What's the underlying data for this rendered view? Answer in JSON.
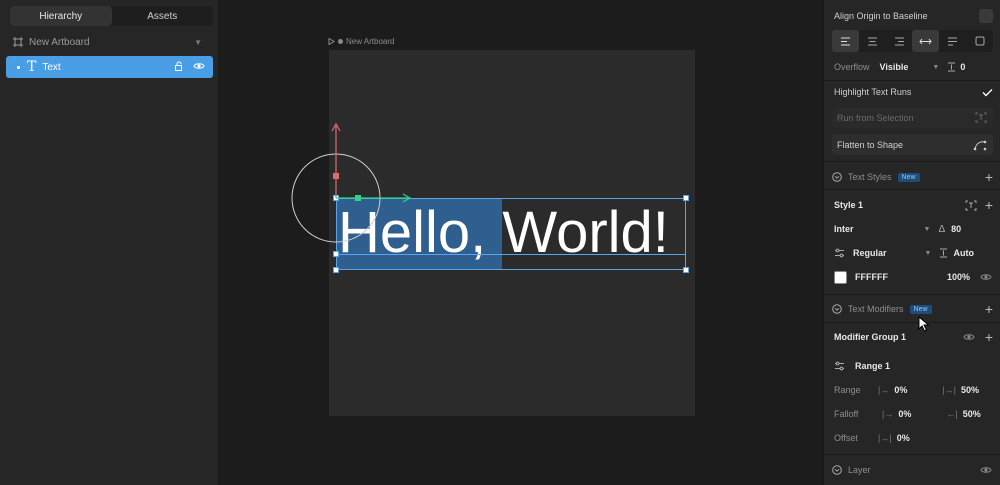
{
  "left": {
    "tabs": [
      "Hierarchy",
      "Assets"
    ],
    "artboard": "New Artboard",
    "layer": "Text"
  },
  "canvas": {
    "artboard_label": "New Artboard",
    "text": "Hello, World!"
  },
  "right": {
    "align_origin": "Align Origin to Baseline",
    "overflow_label": "Overflow",
    "overflow_value": "Visible",
    "overflow_number": "0",
    "highlight_runs": "Highlight Text Runs",
    "run_from_selection": "Run from Selection",
    "flatten": "Flatten to Shape",
    "text_styles": {
      "title": "Text Styles",
      "badge": "New",
      "style_name": "Style 1",
      "font": "Inter",
      "font_size": "80",
      "weight": "Regular",
      "line_height": "Auto",
      "color_hex": "FFFFFF",
      "opacity": "100%"
    },
    "text_modifiers": {
      "title": "Text Modifiers",
      "badge": "New",
      "group": "Modifier Group 1",
      "range_name": "Range 1",
      "range_label": "Range",
      "range_start": "0%",
      "range_end": "50%",
      "falloff_label": "Falloff",
      "falloff_start": "0%",
      "falloff_end": "50%",
      "offset_label": "Offset",
      "offset_value": "0%"
    },
    "layer_title": "Layer"
  },
  "colors": {
    "accent": "#4a9ee6",
    "selection": "#2f5f8e",
    "badge_bg": "#1f4d7a",
    "badge_text": "#8cc6ff"
  }
}
